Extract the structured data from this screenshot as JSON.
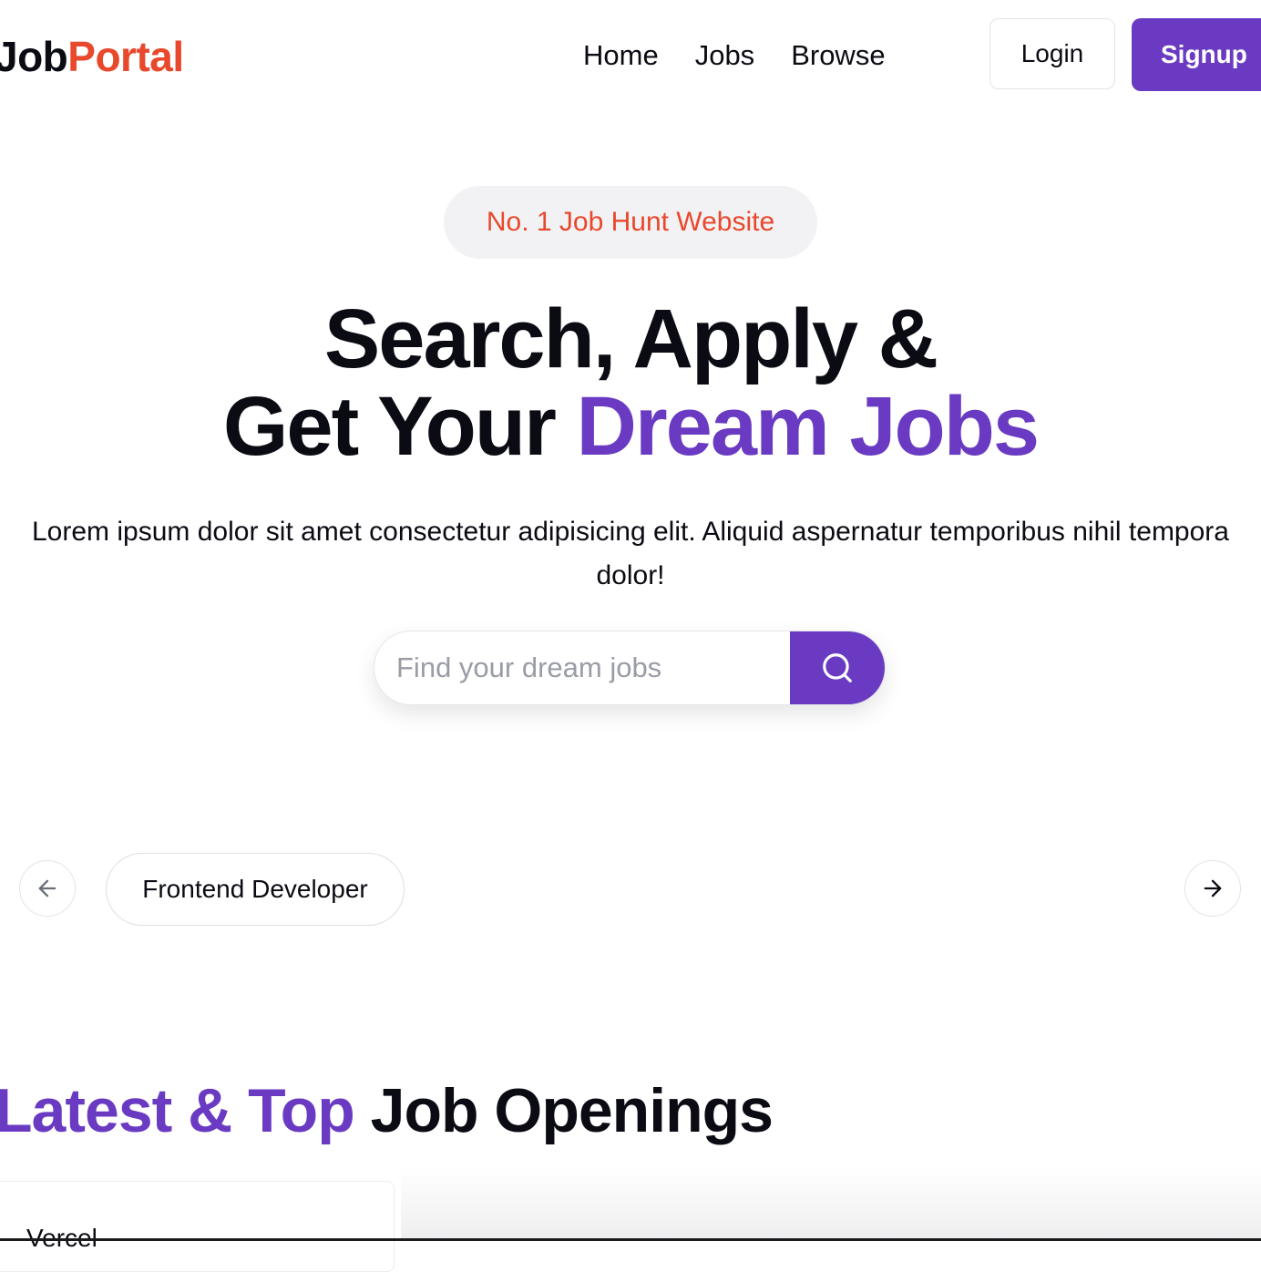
{
  "navbar": {
    "logo": {
      "part1": "Job",
      "part2": "Portal"
    },
    "links": [
      {
        "label": "Home"
      },
      {
        "label": "Jobs"
      },
      {
        "label": "Browse"
      }
    ],
    "login_label": "Login",
    "signup_label": "Signup"
  },
  "hero": {
    "badge": "No. 1 Job Hunt Website",
    "title_line1": "Search, Apply &",
    "title_line2_prefix": "Get Your ",
    "title_line2_accent": "Dream Jobs",
    "description": "Lorem ipsum dolor sit amet consectetur adipisicing elit. Aliquid aspernatur temporibus nihil tempora dolor!",
    "search": {
      "placeholder": "Find your dream jobs",
      "value": "",
      "button_icon": "search-icon"
    }
  },
  "categories": {
    "prev_icon": "arrow-left-icon",
    "next_icon": "arrow-right-icon",
    "items": [
      {
        "label": "Frontend Developer"
      }
    ]
  },
  "latest_jobs": {
    "title_accent": "Latest & Top",
    "title_rest": " Job Openings",
    "cards": [
      {
        "company": "Vercel"
      }
    ]
  },
  "colors": {
    "brand_purple": "#6a3bc2",
    "brand_orange": "#e8482b",
    "text_dark": "#0b0b14",
    "placeholder_gray": "#9a9ca6"
  }
}
